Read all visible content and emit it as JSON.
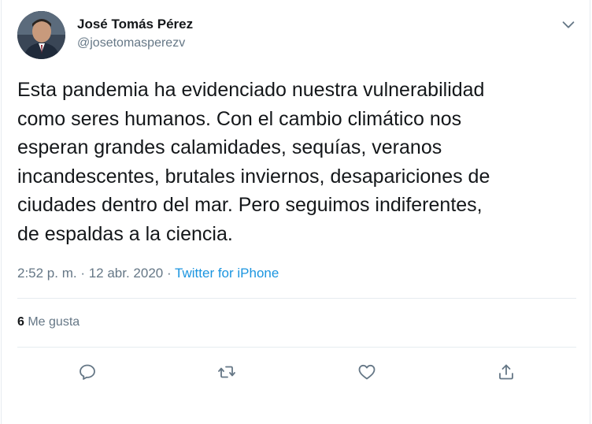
{
  "author": {
    "name": "José Tomás Pérez",
    "handle": "@josetomasperezv"
  },
  "tweet": {
    "text": "Esta pandemia ha evidenciado nuestra vulnerabilidad\ncomo seres humanos. Con el cambio climático nos\nesperan grandes calamidades, sequías, veranos\nincandescentes, brutales inviernos, desapariciones de\nciudades dentro del mar. Pero seguimos indiferentes,\nde espaldas a la ciencia.",
    "time": "2:52 p. m. · 12 abr. 2020",
    "separator": " · ",
    "source": "Twitter for iPhone"
  },
  "stats": {
    "likes_count": "6",
    "likes_label": " Me gusta"
  },
  "actions": [
    {
      "name": "reply",
      "icon": "reply-icon"
    },
    {
      "name": "retweet",
      "icon": "retweet-icon"
    },
    {
      "name": "like",
      "icon": "heart-icon"
    },
    {
      "name": "share",
      "icon": "share-icon"
    }
  ],
  "colors": {
    "text": "#14171a",
    "secondary": "#657786",
    "link": "#1b95e0",
    "divider": "#e6ecf0"
  }
}
